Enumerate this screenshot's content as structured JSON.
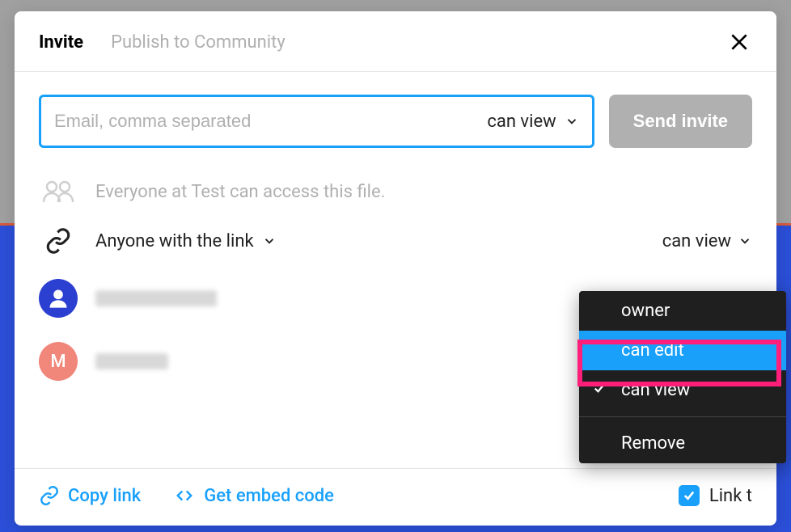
{
  "tabs": {
    "invite": "Invite",
    "publish": "Publish to Community"
  },
  "email": {
    "placeholder": "Email, comma separated",
    "perm": "can view"
  },
  "send_label": "Send invite",
  "org_access": "Everyone at Test can access this file.",
  "link_access": {
    "label": "Anyone with the link",
    "perm": "can view"
  },
  "users": [
    {
      "avatar_letter": "",
      "name": "██████"
    },
    {
      "avatar_letter": "M",
      "name": "████"
    }
  ],
  "footer": {
    "copy": "Copy link",
    "embed": "Get embed code",
    "checkbox_label": "Link t"
  },
  "dropdown": {
    "owner": "owner",
    "can_edit": "can edit",
    "can_view": "can view",
    "remove": "Remove"
  }
}
